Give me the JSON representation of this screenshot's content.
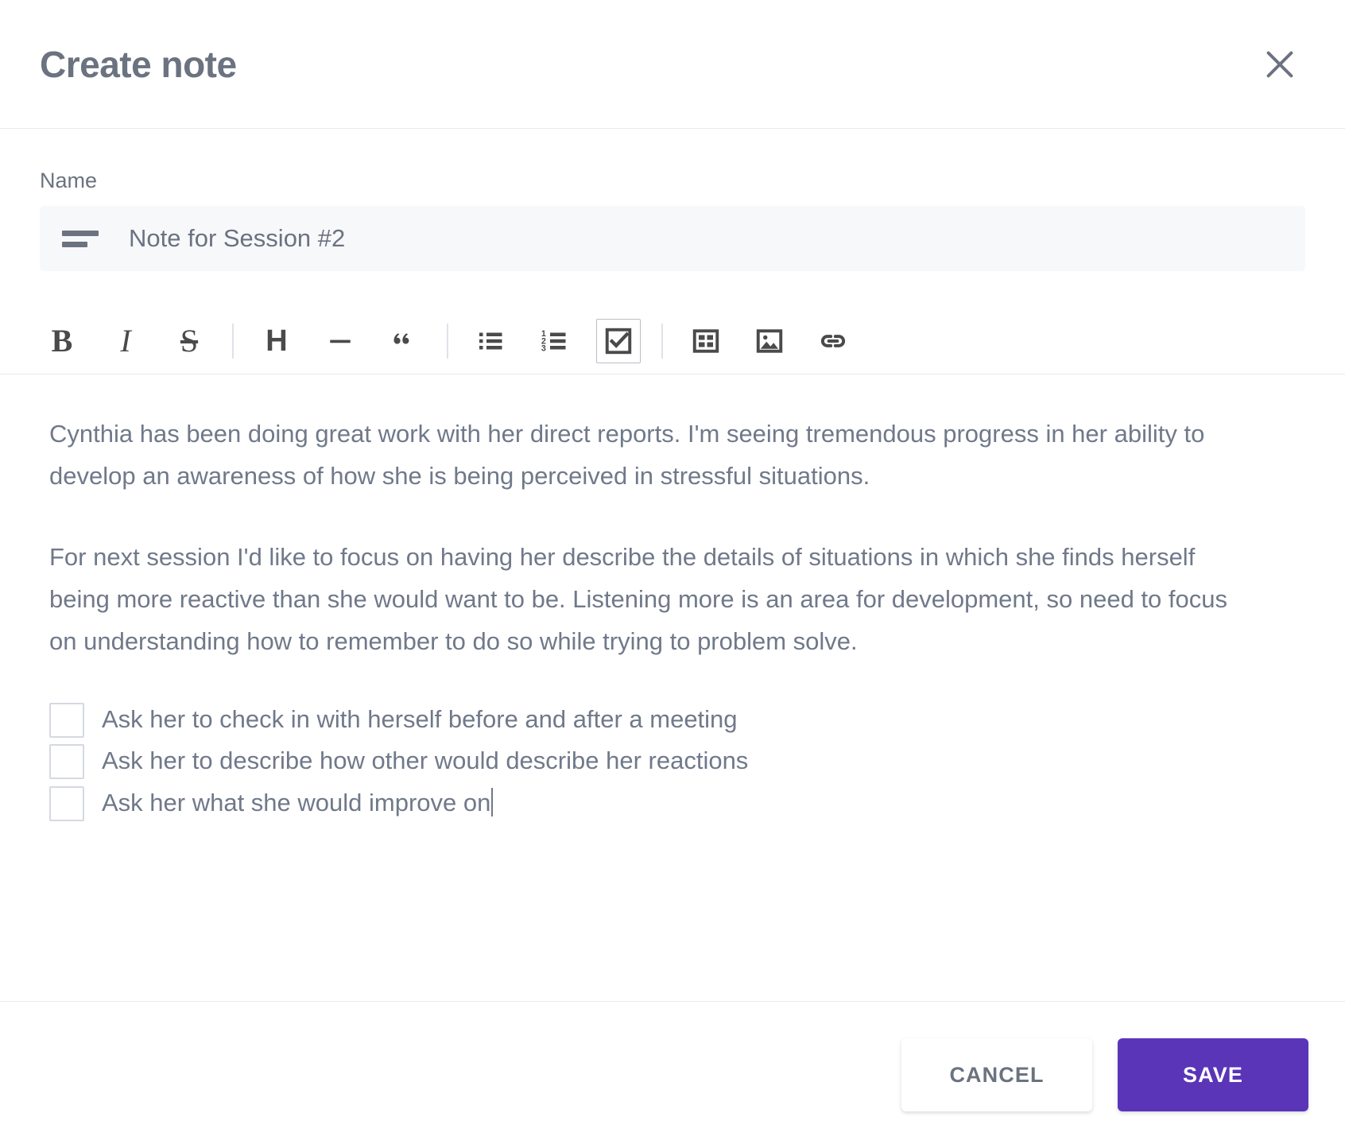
{
  "dialog": {
    "title": "Create note",
    "close_icon": "close-icon"
  },
  "name_field": {
    "label": "Name",
    "value": "Note for Session #2",
    "placeholder": "Note for Session #2",
    "icon": "text-lines-icon"
  },
  "toolbar": {
    "items": [
      {
        "name": "bold-icon",
        "label": "B"
      },
      {
        "name": "italic-icon",
        "label": "I"
      },
      {
        "name": "strikethrough-icon",
        "label": "S"
      },
      {
        "name": "heading-icon",
        "label": "H"
      },
      {
        "name": "horizontal-rule-icon",
        "label": "—"
      },
      {
        "name": "blockquote-icon",
        "label": "“"
      },
      {
        "name": "bullet-list-icon",
        "label": ""
      },
      {
        "name": "numbered-list-icon",
        "label": ""
      },
      {
        "name": "checklist-icon",
        "label": "",
        "active": true
      },
      {
        "name": "table-icon",
        "label": ""
      },
      {
        "name": "image-icon",
        "label": ""
      },
      {
        "name": "link-icon",
        "label": ""
      }
    ]
  },
  "editor": {
    "paragraphs": [
      "Cynthia has been doing great work with her direct reports. I'm seeing tremendous progress in her ability to develop an awareness of how she is being perceived in stressful situations.",
      "For next session I'd like to focus on having her describe the details of situations in which she finds herself being more reactive than she would want to be. Listening more is an area for development, so need to focus on understanding how to remember to do so while trying to problem solve."
    ],
    "checklist": [
      {
        "text": "Ask her to check in with herself before and after a meeting",
        "checked": false
      },
      {
        "text": "Ask her to describe how other would describe her reactions",
        "checked": false
      },
      {
        "text": "Ask her what she would improve on",
        "checked": false,
        "caret": true
      }
    ]
  },
  "footer": {
    "cancel_label": "CANCEL",
    "save_label": "SAVE"
  },
  "colors": {
    "accent": "#5a35b8",
    "text": "#70798a",
    "heading": "#6b7280",
    "field_bg": "#f7f8fa",
    "border": "#e7eaee"
  }
}
